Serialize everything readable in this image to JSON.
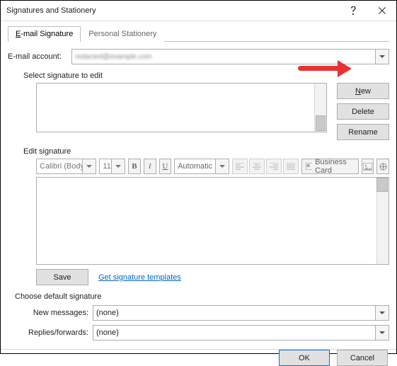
{
  "window": {
    "title": "Signatures and Stationery"
  },
  "tabs": {
    "email": "E-mail Signature",
    "stationery": "Personal Stationery"
  },
  "account": {
    "label": "E-mail account:",
    "value": "redacted@example.com"
  },
  "select_sig": {
    "label": "Select signature to edit",
    "buttons": {
      "new": "New",
      "delete": "Delete",
      "rename": "Rename"
    }
  },
  "edit": {
    "label": "Edit signature",
    "font": "Calibri (Body)",
    "size": "11",
    "auto": "Automatic",
    "bizcard": "Business Card",
    "save": "Save",
    "templates_link": "Get signature templates"
  },
  "defaults": {
    "header": "Choose default signature",
    "new_label": "New messages:",
    "new_value": "(none)",
    "reply_label": "Replies/forwards:",
    "reply_value": "(none)"
  },
  "footer": {
    "ok": "OK",
    "cancel": "Cancel"
  },
  "glyph": {
    "b": "B",
    "i": "I",
    "u": "U"
  }
}
